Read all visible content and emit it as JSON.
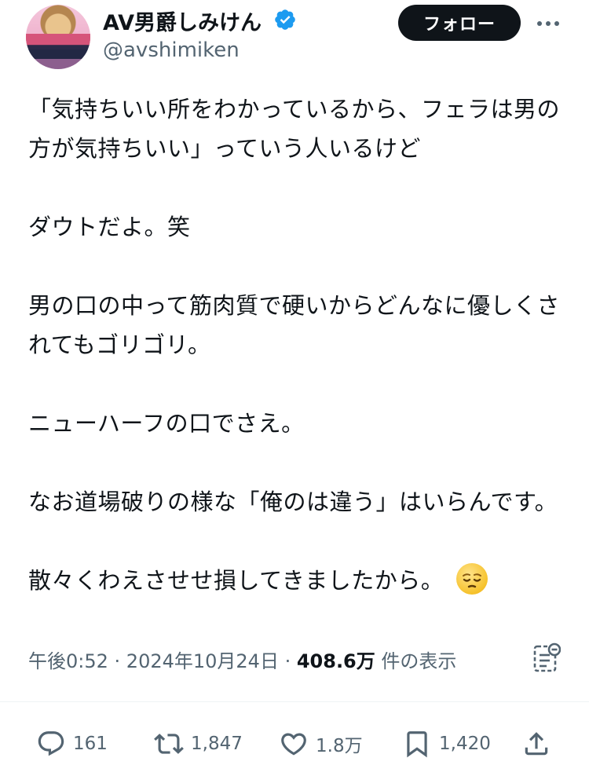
{
  "header": {
    "display_name": "AV男爵しみけん",
    "handle": "@avshimiken",
    "follow_label": "フォロー"
  },
  "tweet": {
    "text": "「気持ちいい所をわかっているから、フェラは男の方が気持ちいい」っていう人いるけど\n\nダウトだよ。笑\n\n男の口の中って筋肉質で硬いからどんなに優しくされてもゴリゴリ。\n\nニューハーフの口でさえ。\n\nなお道場破りの様な「俺のは違う」はいらんです。\n\n散々くわえさせせ損してきましたから。",
    "emoji": "pensive-face"
  },
  "meta": {
    "time": "午後0:52",
    "separator": " · ",
    "date": "2024年10月24日",
    "separator2": " · ",
    "views": "408.6万",
    "views_label": " 件の表示"
  },
  "actions": {
    "reply_count": "161",
    "repost_count": "1,847",
    "like_count": "1.8万",
    "bookmark_count": "1,420"
  },
  "icons": {
    "verified": "verified-badge-icon",
    "more": "more-icon",
    "analytics": "analytics-icon",
    "reply": "reply-icon",
    "repost": "repost-icon",
    "like": "heart-icon",
    "bookmark": "bookmark-icon",
    "share": "share-icon"
  },
  "colors": {
    "verified": "#1d9bf0",
    "text": "#0f1419",
    "secondary": "#536471",
    "follow_bg": "#0f1419"
  }
}
